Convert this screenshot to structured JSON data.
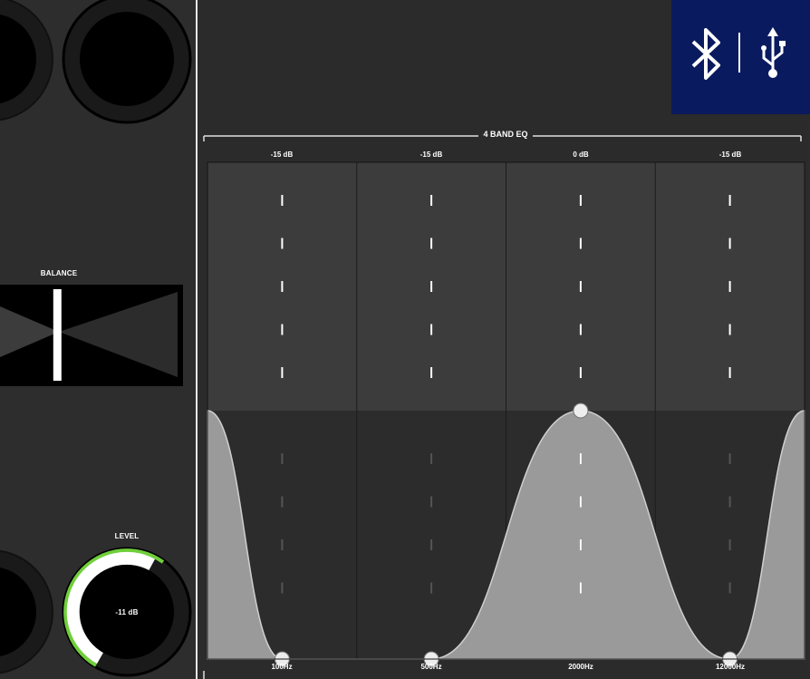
{
  "balance": {
    "label": "BALANCE",
    "position": 0.32
  },
  "level": {
    "label": "LEVEL",
    "value_text": "-11 dB",
    "fraction": 0.62
  },
  "eq": {
    "title": "4 BAND EQ",
    "bands": [
      {
        "gain": "-15 dB",
        "frequency": "100Hz"
      },
      {
        "gain": "-15 dB",
        "frequency": "500Hz"
      },
      {
        "gain": "0 dB",
        "frequency": "2000Hz"
      },
      {
        "gain": "-15 dB",
        "frequency": "12000Hz"
      }
    ]
  },
  "connectivity": {
    "icons": [
      "bluetooth-icon",
      "usb-icon"
    ]
  },
  "colors": {
    "background": "#2d2d2d",
    "eq_fill": "#9a9a9a",
    "level_accent": "#6fcf3a",
    "connectivity_bg": "#0a1a5e"
  }
}
